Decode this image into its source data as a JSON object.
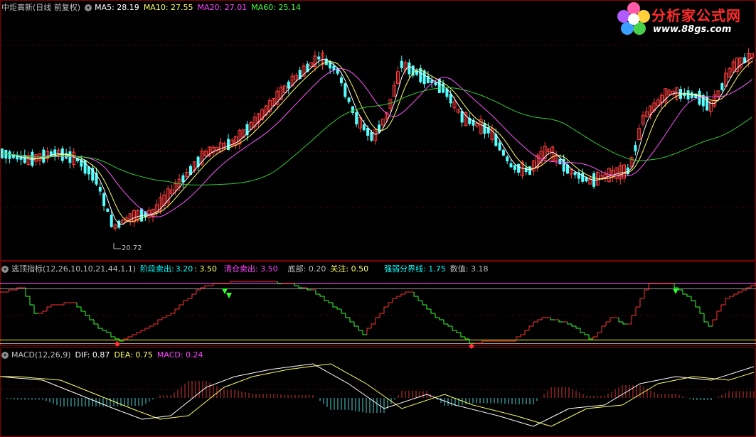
{
  "main_panel": {
    "stock_name": "中炬高新(日线 前复权)",
    "ma5": "MA5: 28.19",
    "ma10": "MA10: 27.55",
    "ma20": "MA20: 27.01",
    "ma60": "MA60: 25.14",
    "low_marker": "20.72"
  },
  "indicator_panel": {
    "name": "逃顶指标(12,26,10,10,21,44,1,1)",
    "stage_sell_label": "阶段卖出:",
    "stage_sell_value1": "3.20",
    "stage_sell_value2": ": 3.50",
    "clear_sell": "清仓卖出: 3.50",
    "bottom": "底部: 0.20",
    "watch": "关注: 0.50",
    "divider": "强弱分界线: 1.75",
    "value": "数值: 3.18"
  },
  "macd_panel": {
    "name": "MACD(12,26,9)",
    "dif": "DIF: 0.87",
    "dea": "DEA: 0.75",
    "macd": "MACD: 0.24"
  },
  "logo": {
    "title": "分析家公式网",
    "url": "www.88gs.com"
  },
  "colors": {
    "up": "#ff3c3c",
    "down": "#54ffff",
    "ma5": "#ffffff",
    "ma10": "#ffff66",
    "ma20": "#ff55ff",
    "ma60": "#33cc33",
    "indicator_up": "#ff3333",
    "indicator_down": "#33ff33",
    "line_purple": "#ff66ff",
    "line_yellow": "#ffff00",
    "label_gray": "#c0c0c0",
    "label_cyan": "#00ffff",
    "label_magenta": "#ff44ff",
    "label_green": "#44ff44"
  },
  "chart_data": {
    "type": "line",
    "main_series_last_values": {
      "MA5": 28.19,
      "MA10": 27.55,
      "MA20": 27.01,
      "MA60": 25.14
    },
    "main_low": 20.72,
    "indicator_levels": {
      "stage_sell": 3.2,
      "clear_sell": 3.5,
      "bottom": 0.2,
      "watch": 0.5,
      "divider": 1.75,
      "value": 3.18
    },
    "macd_last": {
      "DIF": 0.87,
      "DEA": 0.75,
      "MACD": 0.24
    }
  }
}
